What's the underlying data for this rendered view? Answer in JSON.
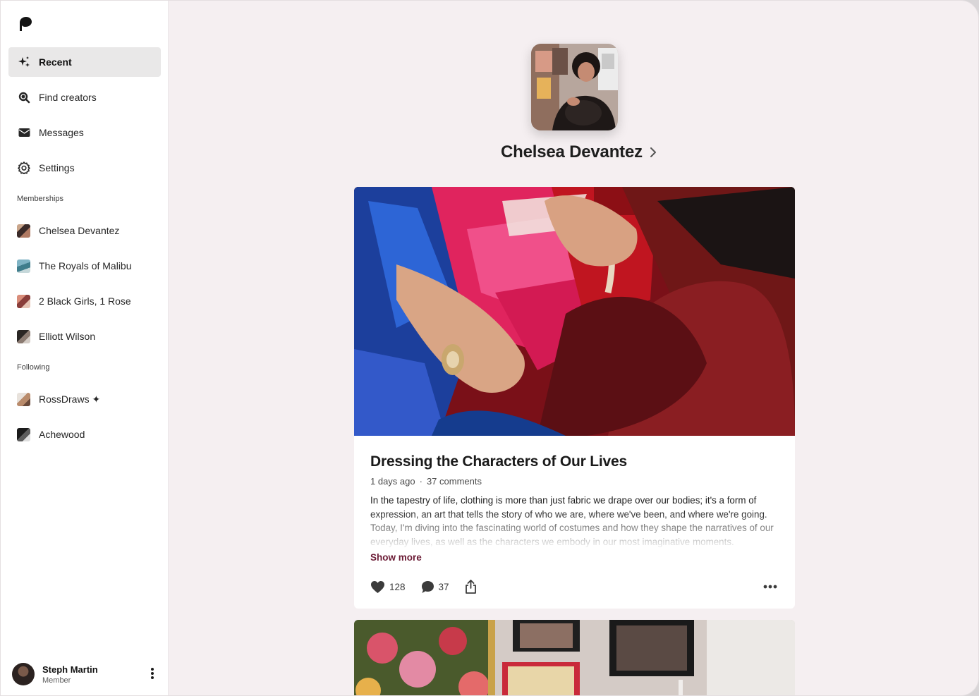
{
  "sidebar": {
    "nav": [
      {
        "label": "Recent",
        "icon": "sparkle-icon",
        "active": true
      },
      {
        "label": "Find creators",
        "icon": "search-icon",
        "active": false
      },
      {
        "label": "Messages",
        "icon": "envelope-icon",
        "active": false
      },
      {
        "label": "Settings",
        "icon": "gear-icon",
        "active": false
      }
    ],
    "memberships_label": "Memberships",
    "memberships": [
      {
        "label": "Chelsea Devantez"
      },
      {
        "label": "The Royals of Malibu"
      },
      {
        "label": "2 Black Girls, 1 Rose"
      },
      {
        "label": "Elliott Wilson"
      }
    ],
    "following_label": "Following",
    "following": [
      {
        "label": "RossDraws ✦"
      },
      {
        "label": "Achewood"
      }
    ],
    "user": {
      "name": "Steph Martin",
      "role": "Member"
    }
  },
  "creator": {
    "name": "Chelsea Devantez"
  },
  "post": {
    "title": "Dressing the Characters of Our Lives",
    "time": "1 days ago",
    "separator": "·",
    "comments_text": "37 comments",
    "body": "In the tapestry of life, clothing is more than just fabric we drape over our bodies; it's a form of expression, an art that tells the story of who we are, where we've been, and where we're going. Today, I'm diving into the fascinating world of costumes and how they shape the narratives of our everyday lives, as well as the characters we embody in our most imaginative moments.",
    "show_more": "Show more",
    "likes": "128",
    "comments": "37"
  },
  "colors": {
    "accent": "#6b1b35",
    "background": "#f5eff1",
    "active_nav": "#e9e8e8"
  }
}
